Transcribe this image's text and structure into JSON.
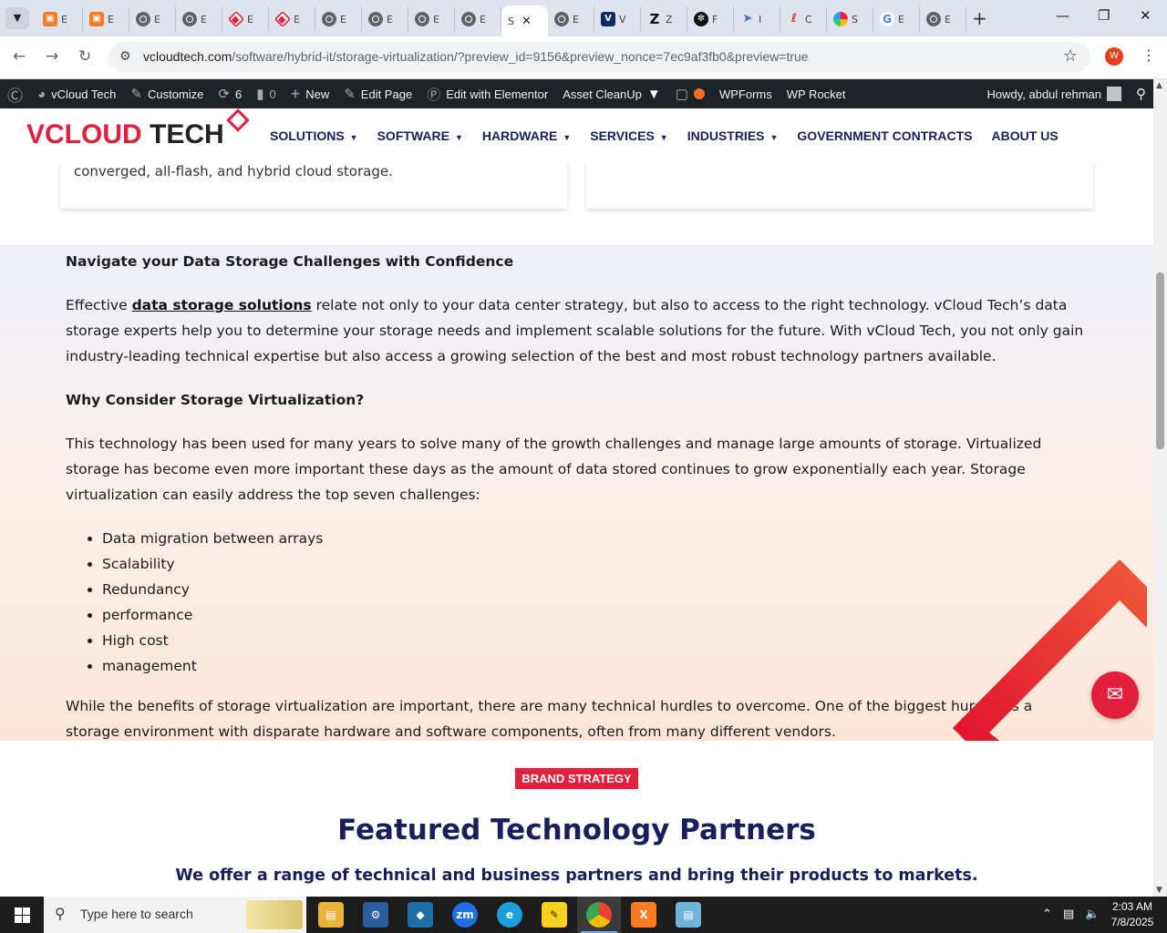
{
  "browser": {
    "tabs": [
      {
        "letter": "E",
        "icon": "xampp-icon"
      },
      {
        "letter": "E",
        "icon": "xampp-icon"
      },
      {
        "letter": "E",
        "icon": "globe-icon"
      },
      {
        "letter": "E",
        "icon": "globe-icon"
      },
      {
        "letter": "E",
        "icon": "elementor-icon"
      },
      {
        "letter": "E",
        "icon": "elementor-icon"
      },
      {
        "letter": "E",
        "icon": "globe-icon"
      },
      {
        "letter": "E",
        "icon": "globe-icon"
      },
      {
        "letter": "E",
        "icon": "globe-icon"
      },
      {
        "letter": "E",
        "icon": "globe-icon"
      },
      {
        "letter": "S",
        "icon": "none",
        "active": true
      },
      {
        "letter": "E",
        "icon": "globe-icon"
      },
      {
        "letter": "V",
        "icon": "vcloud-icon"
      },
      {
        "letter": "Z",
        "icon": "z-icon"
      },
      {
        "letter": "F",
        "icon": "chatgpt-icon"
      },
      {
        "letter": "I",
        "icon": "nav-icon"
      },
      {
        "letter": "C",
        "icon": "acrobat-icon"
      },
      {
        "letter": "S",
        "icon": "color-circle-icon"
      },
      {
        "letter": "E",
        "icon": "google-icon"
      },
      {
        "letter": "E",
        "icon": "globe-icon"
      }
    ],
    "url_host": "vcloudtech.com",
    "url_path": "/software/hybrid-it/storage-virtualization/?preview_id=9156&preview_nonce=7ec9af3fb0&preview=true",
    "profile_letter": "W"
  },
  "adminbar": {
    "site_name": "vCloud Tech",
    "customize": "Customize",
    "updates_count": "6",
    "comments_count": "0",
    "new_label": "New",
    "edit_page": "Edit Page",
    "edit_elementor": "Edit with Elementor",
    "asset_cleanup": "Asset CleanUp",
    "wpforms": "WPForms",
    "wprocket": "WP Rocket",
    "howdy": "Howdy, abdul rehman"
  },
  "header": {
    "logo_part1": "VCLOUD",
    "logo_part2": "TECH",
    "nav": [
      {
        "label": "SOLUTIONS",
        "dropdown": true
      },
      {
        "label": "SOFTWARE",
        "dropdown": true
      },
      {
        "label": "HARDWARE",
        "dropdown": true
      },
      {
        "label": "SERVICES",
        "dropdown": true
      },
      {
        "label": "INDUSTRIES",
        "dropdown": true
      },
      {
        "label": "GOVERNMENT CONTRACTS",
        "dropdown": false
      },
      {
        "label": "ABOUT US",
        "dropdown": false
      }
    ]
  },
  "cards": {
    "left_text": "converged, all-flash, and hybrid cloud storage."
  },
  "section": {
    "heading1": "Navigate your Data Storage Challenges with Confidence",
    "p1_before": "Effective ",
    "p1_link": "data storage solutions",
    "p1_after": " relate not only to your data center strategy, but also to access to the right technology. vCloud Tech’s data storage experts help you to determine your storage needs and implement scalable solutions for the future. With vCloud Tech, you not only gain industry-leading technical expertise but also access a growing selection of the best and most robust technology partners available.",
    "heading2": "Why Consider Storage Virtualization?",
    "p2": "This technology has been used for many years to solve many of the growth challenges and manage large amounts of storage. Virtualized storage has become even more important these days as the amount of data stored continues to grow exponentially each year. Storage virtualization can easily  address the  top seven challenges:",
    "list": [
      "Data migration between arrays",
      "Scalability",
      "Redundancy",
      "performance",
      "High cost",
      "management"
    ],
    "p3": "While the benefits of storage virtualization are important, there are many technical hurdles to overcome. One of the biggest hurdles is a storage environment with disparate hardware and software components, often from many different vendors."
  },
  "partners": {
    "badge": "BRAND STRATEGY",
    "title": "Featured Technology Partners",
    "subtitle": "We offer a range of technical and business partners and bring their products to markets."
  },
  "taskbar": {
    "search_placeholder": "Type here to search",
    "time": "2:03 AM",
    "date": "7/8/2025"
  },
  "colors": {
    "brand_red": "#e31f3e",
    "brand_navy": "#1a1f5c",
    "adminbar_bg": "#1d2327"
  }
}
